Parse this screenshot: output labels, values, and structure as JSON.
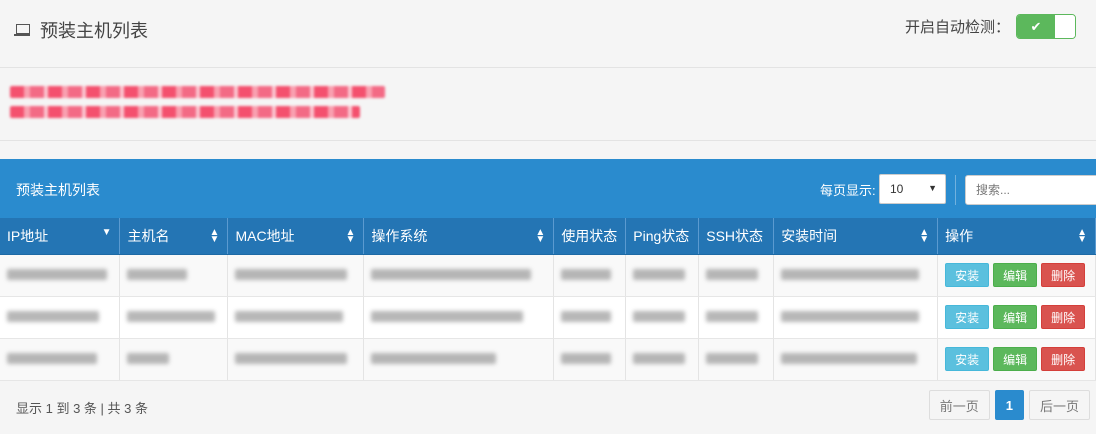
{
  "header": {
    "title": "预装主机列表",
    "autodetect_label": "开启自动检测：",
    "toggle_on": "✔"
  },
  "panel": {
    "title": "预装主机列表",
    "perpage_label": "每页显示:",
    "perpage_value": "10",
    "search_placeholder": "搜索..."
  },
  "table": {
    "columns": [
      "IP地址",
      "主机名",
      "MAC地址",
      "操作系统",
      "使用状态",
      "Ping状态",
      "SSH状态",
      "安装时间",
      "操作"
    ],
    "actions": {
      "install": "安装",
      "edit": "编辑",
      "delete": "删除"
    }
  },
  "footer": {
    "summary": "显示 1 到 3 条 | 共 3 条",
    "prev": "前一页",
    "page": "1",
    "next": "后一页"
  }
}
